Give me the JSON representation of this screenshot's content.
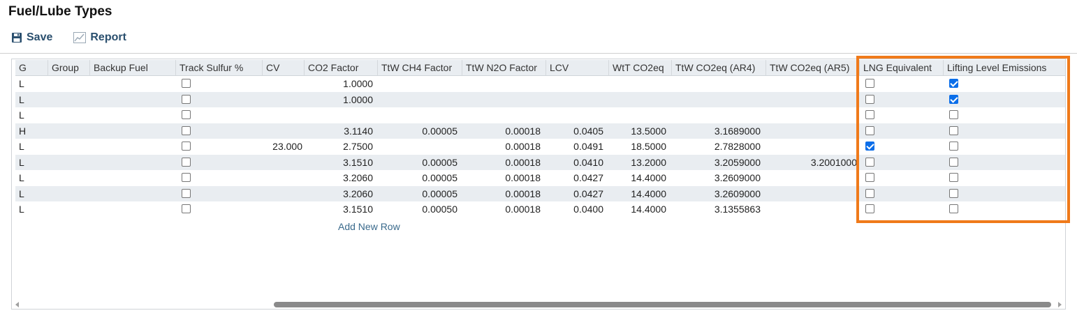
{
  "page": {
    "title": "Fuel/Lube Types"
  },
  "toolbar": {
    "save_label": "Save",
    "report_label": "Report"
  },
  "grid": {
    "columns": [
      "G",
      "Group",
      "Backup Fuel",
      "Track Sulfur %",
      "CV",
      "CO2 Factor",
      "TtW CH4 Factor",
      "TtW N2O Factor",
      "LCV",
      "WtT CO2eq",
      "TtW CO2eq (AR4)",
      "TtW CO2eq (AR5)",
      "LNG Equivalent",
      "Lifting Level Emissions"
    ],
    "rows": [
      {
        "g": "L",
        "group": "",
        "backup": "",
        "sulfur": false,
        "cv": "",
        "co2": "1.0000",
        "ch4": "",
        "n2o": "",
        "lcv": "",
        "wtt": "",
        "ar4": "",
        "ar5": "",
        "lng": false,
        "lift": true
      },
      {
        "g": "L",
        "group": "",
        "backup": "",
        "sulfur": false,
        "cv": "",
        "co2": "1.0000",
        "ch4": "",
        "n2o": "",
        "lcv": "",
        "wtt": "",
        "ar4": "",
        "ar5": "",
        "lng": false,
        "lift": true
      },
      {
        "g": "L",
        "group": "",
        "backup": "",
        "sulfur": false,
        "cv": "",
        "co2": "",
        "ch4": "",
        "n2o": "",
        "lcv": "",
        "wtt": "",
        "ar4": "",
        "ar5": "",
        "lng": false,
        "lift": false
      },
      {
        "g": "H",
        "group": "",
        "backup": "",
        "sulfur": false,
        "cv": "",
        "co2": "3.1140",
        "ch4": "0.00005",
        "n2o": "0.00018",
        "lcv": "0.0405",
        "wtt": "13.5000",
        "ar4": "3.1689000",
        "ar5": "",
        "lng": false,
        "lift": false
      },
      {
        "g": "L",
        "group": "",
        "backup": "",
        "sulfur": false,
        "cv": "23.000",
        "co2": "2.7500",
        "ch4": "",
        "n2o": "0.00018",
        "lcv": "0.0491",
        "wtt": "18.5000",
        "ar4": "2.7828000",
        "ar5": "",
        "lng": true,
        "lift": false
      },
      {
        "g": "L",
        "group": "",
        "backup": "",
        "sulfur": false,
        "cv": "",
        "co2": "3.1510",
        "ch4": "0.00005",
        "n2o": "0.00018",
        "lcv": "0.0410",
        "wtt": "13.2000",
        "ar4": "3.2059000",
        "ar5": "3.2001000",
        "lng": false,
        "lift": false
      },
      {
        "g": "L",
        "group": "",
        "backup": "",
        "sulfur": false,
        "cv": "",
        "co2": "3.2060",
        "ch4": "0.00005",
        "n2o": "0.00018",
        "lcv": "0.0427",
        "wtt": "14.4000",
        "ar4": "3.2609000",
        "ar5": "",
        "lng": false,
        "lift": false
      },
      {
        "g": "L",
        "group": "",
        "backup": "",
        "sulfur": false,
        "cv": "",
        "co2": "3.2060",
        "ch4": "0.00005",
        "n2o": "0.00018",
        "lcv": "0.0427",
        "wtt": "14.4000",
        "ar4": "3.2609000",
        "ar5": "",
        "lng": false,
        "lift": false
      },
      {
        "g": "L",
        "group": "",
        "backup": "",
        "sulfur": false,
        "cv": "",
        "co2": "3.1510",
        "ch4": "0.00050",
        "n2o": "0.00018",
        "lcv": "0.0400",
        "wtt": "14.4000",
        "ar4": "3.1355863",
        "ar5": "",
        "lng": false,
        "lift": false
      }
    ],
    "add_row_label": "Add New Row"
  },
  "icons": {
    "save": "floppy-disk-icon",
    "report": "line-chart-icon"
  },
  "colors": {
    "highlight": "#f07a1a",
    "header_bg": "#e9edf1",
    "link": "#3a6a8c",
    "checkbox_checked": "#0b6ee9"
  }
}
